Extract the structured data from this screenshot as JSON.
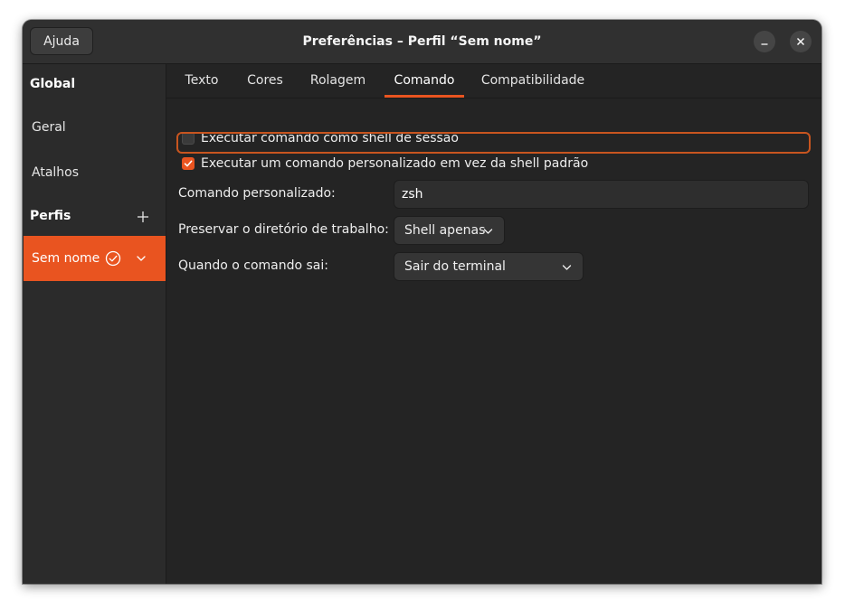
{
  "window": {
    "title": "Preferências – Perfil “Sem nome”",
    "help_label": "Ajuda",
    "minimize_icon": "minimize-icon",
    "close_icon": "close-icon"
  },
  "sidebar": {
    "global_heading": "Global",
    "items": [
      {
        "label": "Geral"
      },
      {
        "label": "Atalhos"
      }
    ],
    "profiles_heading": "Perfis",
    "add_icon": "plus-icon",
    "profile": {
      "label": "Sem nome",
      "default_icon": "check-circle-icon",
      "menu_icon": "chevron-down-icon"
    }
  },
  "tabs": [
    {
      "label": "Texto",
      "active": false
    },
    {
      "label": "Cores",
      "active": false
    },
    {
      "label": "Rolagem",
      "active": false
    },
    {
      "label": "Comando",
      "active": true
    },
    {
      "label": "Compatibilidade",
      "active": false
    }
  ],
  "command": {
    "login_shell": {
      "label": "Executar comando como shell de sessão",
      "checked": false
    },
    "custom_command": {
      "label": "Executar um comando personalizado em vez da shell padrão",
      "checked": true
    },
    "custom_command_label": "Comando personalizado:",
    "custom_command_value": "zsh",
    "preserve_dir_label": "Preservar o diretório de trabalho:",
    "preserve_dir_value": "Shell apenas",
    "on_exit_label": "Quando o comando sai:",
    "on_exit_value": "Sair do terminal"
  },
  "colors": {
    "accent": "#e95420",
    "window_bg": "#242424",
    "sidebar_bg": "#2b2b2b",
    "titlebar_bg": "#303030"
  }
}
